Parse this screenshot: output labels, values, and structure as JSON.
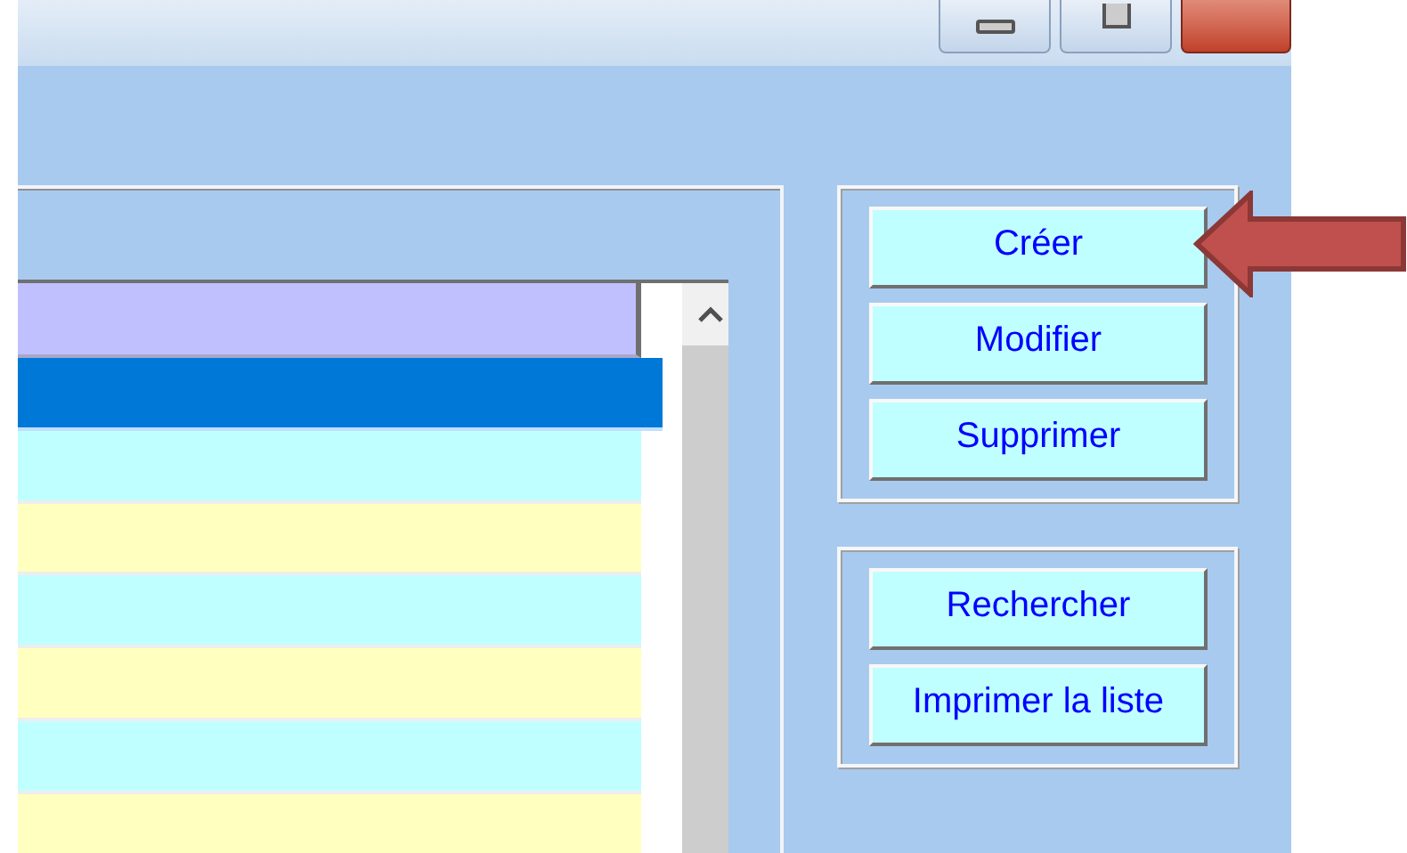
{
  "list": {
    "rows": [
      {
        "selected": true
      },
      {
        "selected": false
      },
      {
        "selected": false
      },
      {
        "selected": false
      },
      {
        "selected": false
      },
      {
        "selected": false
      },
      {
        "selected": false
      }
    ]
  },
  "button_groups": [
    {
      "buttons": [
        "Créer",
        "Modifier",
        "Supprimer"
      ]
    },
    {
      "buttons": [
        "Rechercher",
        "Imprimer la liste"
      ]
    }
  ]
}
